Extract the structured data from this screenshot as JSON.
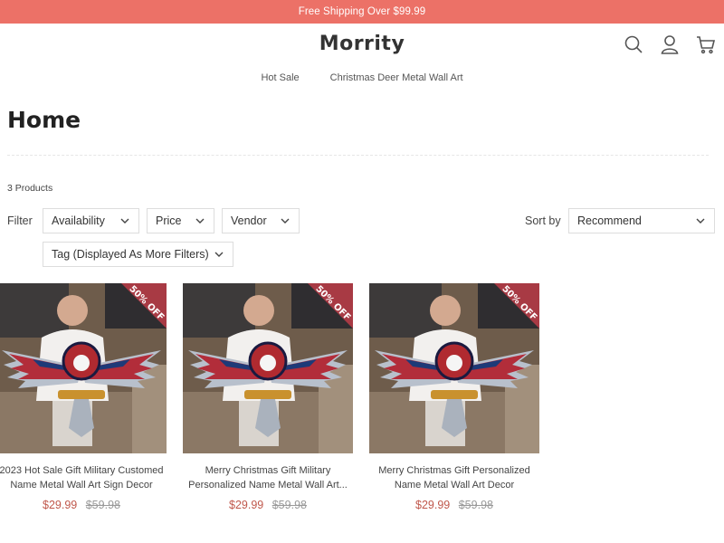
{
  "announcement": "Free Shipping Over $99.99",
  "header": {
    "logo": "Morrity",
    "icons": [
      "search-icon",
      "account-icon",
      "cart-icon"
    ]
  },
  "nav": {
    "items": [
      "Hot Sale",
      "Christmas Deer Metal Wall Art"
    ]
  },
  "collection": {
    "title": "Home",
    "product_count": "3 Products"
  },
  "filters": {
    "label": "Filter",
    "items": [
      "Availability",
      "Price",
      "Vendor",
      "Tag (Displayed As More Filters)"
    ]
  },
  "sort": {
    "label": "Sort by",
    "selected": "Recommend"
  },
  "products": [
    {
      "badge": "50% OFF",
      "title_line1": "2023 Hot Sale Gift Military Customed",
      "title_line2": "Name Metal Wall Art Sign Decor",
      "price": "$29.99",
      "compare_price": "$59.98"
    },
    {
      "badge": "50% OFF",
      "title_line1": "Merry Christmas Gift Military",
      "title_line2": "Personalized Name Metal Wall Art...",
      "price": "$29.99",
      "compare_price": "$59.98"
    },
    {
      "badge": "50% OFF",
      "title_line1": "Merry Christmas Gift Personalized",
      "title_line2": "Name Metal Wall Art Decor",
      "price": "$29.99",
      "compare_price": "$59.98"
    }
  ],
  "colors": {
    "announcement_bg": "#ec7167",
    "badge_bg": "#a83a44",
    "sale_price": "#c0584c"
  }
}
